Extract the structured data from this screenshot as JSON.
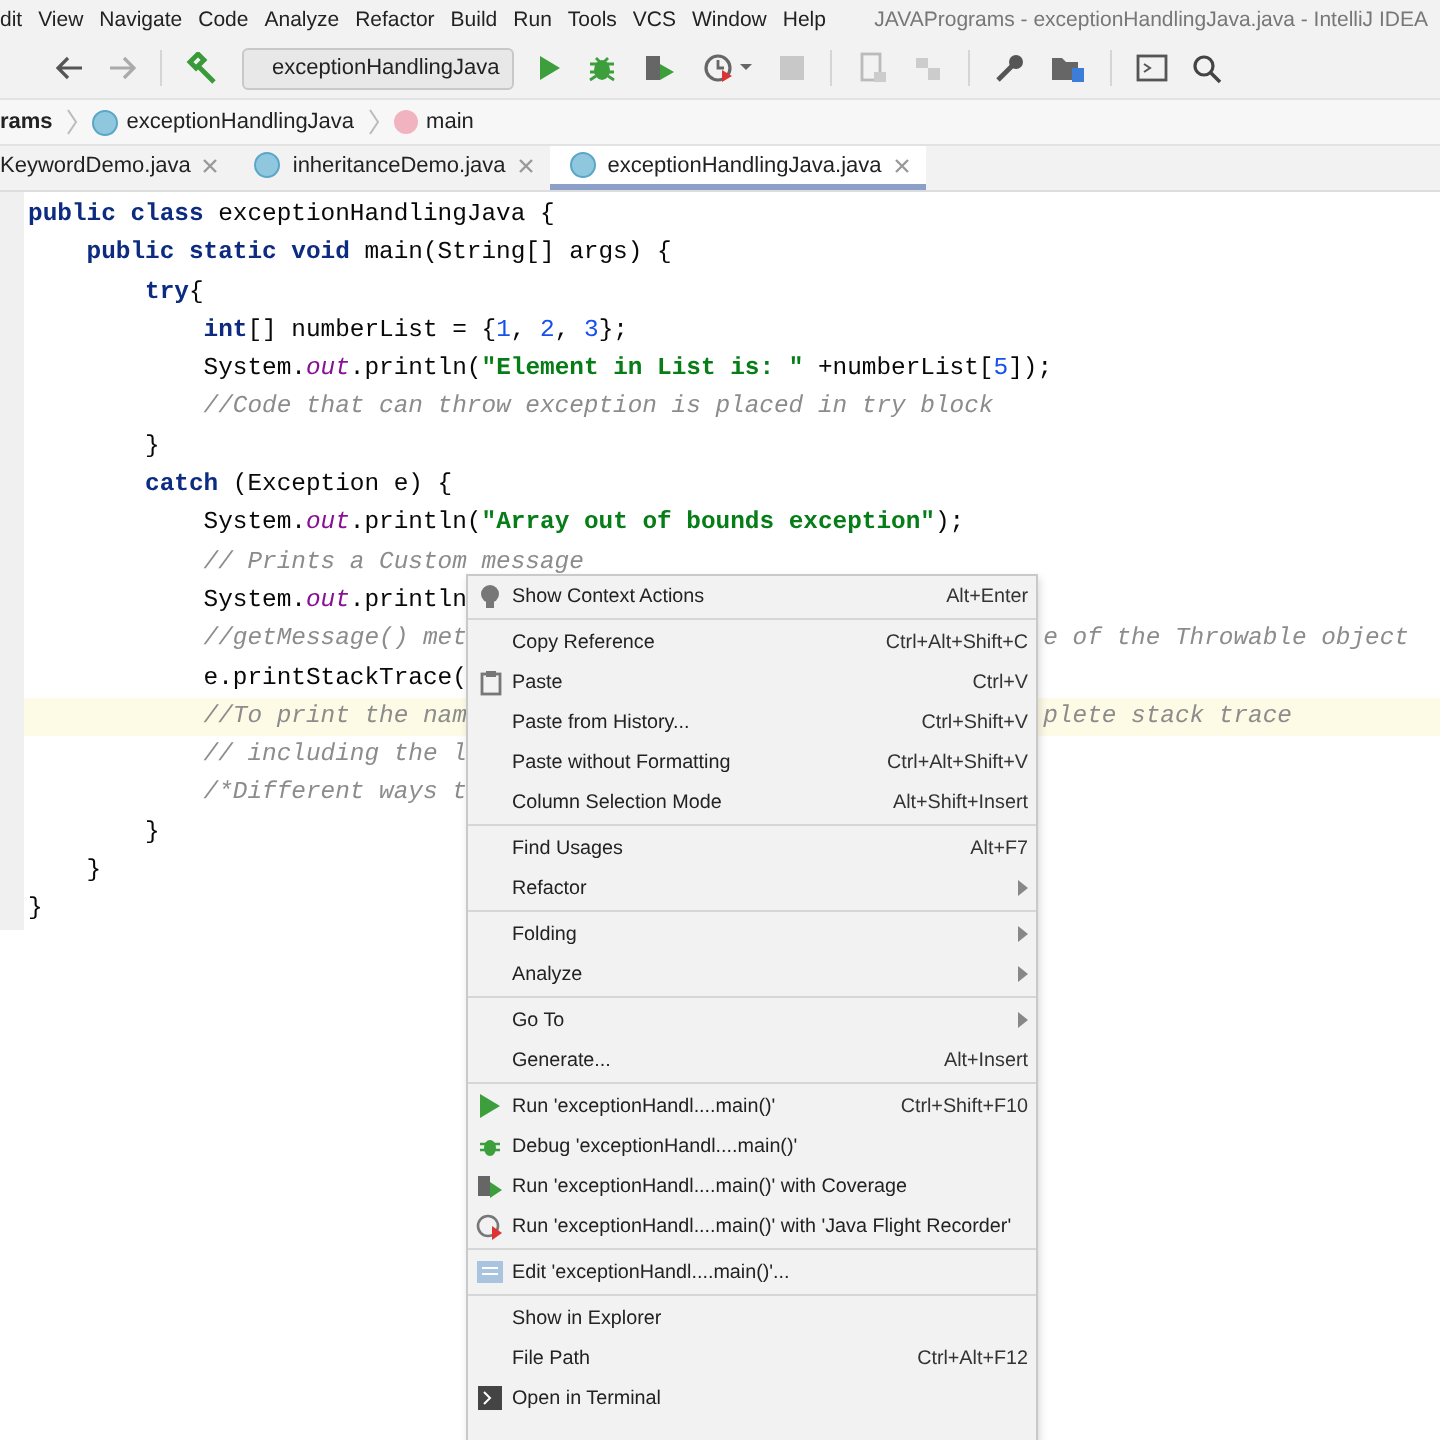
{
  "menubar": [
    "dit",
    "View",
    "Navigate",
    "Code",
    "Analyze",
    "Refactor",
    "Build",
    "Run",
    "Tools",
    "VCS",
    "Window",
    "Help"
  ],
  "window": {
    "title": "JAVAPrograms - exceptionHandlingJava.java - IntelliJ IDEA"
  },
  "toolbar": {
    "run_config": "exceptionHandlingJava"
  },
  "breadcrumbs": [
    {
      "label": "rams",
      "kind": "project"
    },
    {
      "label": "exceptionHandlingJava",
      "kind": "class"
    },
    {
      "label": "main",
      "kind": "method"
    }
  ],
  "tabs": [
    {
      "label": "KeywordDemo.java",
      "selected": false,
      "icon": false
    },
    {
      "label": "inheritanceDemo.java",
      "selected": false,
      "icon": true
    },
    {
      "label": "exceptionHandlingJava.java",
      "selected": true,
      "icon": true
    }
  ],
  "code": [
    {
      "current": false,
      "segments": [
        {
          "text": "public class ",
          "kind": "keyword"
        },
        {
          "text": "exceptionHandlingJava {",
          "kind": "plain"
        }
      ]
    },
    {
      "current": false,
      "segments": [
        {
          "text": "    public static void ",
          "kind": "keyword"
        },
        {
          "text": "main(String[] args) {",
          "kind": "plain"
        }
      ]
    },
    {
      "current": false,
      "segments": [
        {
          "text": "        try",
          "kind": "keyword"
        },
        {
          "text": "{",
          "kind": "plain"
        }
      ]
    },
    {
      "current": false,
      "segments": [
        {
          "text": "            int",
          "kind": "keyword"
        },
        {
          "text": "[] numberList = {",
          "kind": "plain"
        },
        {
          "text": "1",
          "kind": "number"
        },
        {
          "text": ", ",
          "kind": "plain"
        },
        {
          "text": "2",
          "kind": "number"
        },
        {
          "text": ", ",
          "kind": "plain"
        },
        {
          "text": "3",
          "kind": "number"
        },
        {
          "text": "};",
          "kind": "plain"
        }
      ]
    },
    {
      "current": false,
      "segments": [
        {
          "text": "            System.",
          "kind": "plain"
        },
        {
          "text": "out",
          "kind": "field"
        },
        {
          "text": ".println(",
          "kind": "plain"
        },
        {
          "text": "\"Element in List is: \"",
          "kind": "string"
        },
        {
          "text": " +numberList[",
          "kind": "plain"
        },
        {
          "text": "5",
          "kind": "number"
        },
        {
          "text": "]);",
          "kind": "plain"
        }
      ]
    },
    {
      "current": false,
      "segments": [
        {
          "text": "            //Code that can throw exception is placed in try block",
          "kind": "comment"
        }
      ]
    },
    {
      "current": false,
      "segments": [
        {
          "text": "        }",
          "kind": "plain"
        }
      ]
    },
    {
      "current": false,
      "segments": [
        {
          "text": "        catch ",
          "kind": "keyword"
        },
        {
          "text": "(Exception e) {",
          "kind": "plain"
        }
      ]
    },
    {
      "current": false,
      "segments": [
        {
          "text": "            System.",
          "kind": "plain"
        },
        {
          "text": "out",
          "kind": "field"
        },
        {
          "text": ".println(",
          "kind": "plain"
        },
        {
          "text": "\"Array out of bounds exception\"",
          "kind": "string"
        },
        {
          "text": ");",
          "kind": "plain"
        }
      ]
    },
    {
      "current": false,
      "segments": [
        {
          "text": "            // Prints a Custom message",
          "kind": "comment"
        }
      ]
    },
    {
      "current": false,
      "segments": [
        {
          "text": "            System.",
          "kind": "plain"
        },
        {
          "text": "out",
          "kind": "field"
        },
        {
          "text": ".println",
          "kind": "plain"
        }
      ]
    },
    {
      "current": false,
      "segments": [
        {
          "text": "            //getMessage() met",
          "kind": "comment"
        }
      ],
      "after_menu": {
        "text": "e of the Throwable object",
        "kind": "comment"
      }
    },
    {
      "current": false,
      "segments": [
        {
          "text": "            e.printStackTrace(",
          "kind": "plain"
        }
      ]
    },
    {
      "current": true,
      "segments": [
        {
          "text": "            //To print the nam",
          "kind": "comment"
        }
      ],
      "after_menu": {
        "text": "plete stack trace",
        "kind": "comment"
      }
    },
    {
      "current": false,
      "segments": [
        {
          "text": "            // including the l",
          "kind": "comment"
        }
      ]
    },
    {
      "current": false,
      "segments": [
        {
          "text": "            /*Different ways t",
          "kind": "comment"
        }
      ]
    },
    {
      "current": false,
      "segments": [
        {
          "text": "        }",
          "kind": "plain"
        }
      ]
    },
    {
      "current": false,
      "segments": [
        {
          "text": "    }",
          "kind": "plain"
        }
      ]
    },
    {
      "current": false,
      "segments": [
        {
          "text": "}",
          "kind": "plain"
        }
      ]
    }
  ],
  "context_menu": [
    [
      {
        "label": "Show Context Actions",
        "shortcut": "Alt+Enter",
        "submenu": false,
        "kind": "bulb"
      }
    ],
    [
      {
        "label": "Copy Reference",
        "shortcut": "Ctrl+Alt+Shift+C",
        "submenu": false,
        "kind": "plain"
      },
      {
        "label": "Paste",
        "shortcut": "Ctrl+V",
        "submenu": false,
        "kind": "clipboard"
      },
      {
        "label": "Paste from History...",
        "shortcut": "Ctrl+Shift+V",
        "submenu": false,
        "kind": "plain"
      },
      {
        "label": "Paste without Formatting",
        "shortcut": "Ctrl+Alt+Shift+V",
        "submenu": false,
        "kind": "plain"
      },
      {
        "label": "Column Selection Mode",
        "shortcut": "Alt+Shift+Insert",
        "submenu": false,
        "kind": "plain"
      }
    ],
    [
      {
        "label": "Find Usages",
        "shortcut": "Alt+F7",
        "submenu": false,
        "kind": "plain"
      },
      {
        "label": "Refactor",
        "submenu": true,
        "kind": "plain"
      }
    ],
    [
      {
        "label": "Folding",
        "submenu": true,
        "kind": "plain"
      },
      {
        "label": "Analyze",
        "submenu": true,
        "kind": "plain"
      }
    ],
    [
      {
        "label": "Go To",
        "submenu": true,
        "kind": "plain"
      },
      {
        "label": "Generate...",
        "shortcut": "Alt+Insert",
        "submenu": false,
        "kind": "plain"
      }
    ],
    [
      {
        "label": "Run 'exceptionHandl....main()'",
        "shortcut": "Ctrl+Shift+F10",
        "submenu": false,
        "kind": "run"
      },
      {
        "label": "Debug 'exceptionHandl....main()'",
        "submenu": false,
        "kind": "debug"
      },
      {
        "label": "Run 'exceptionHandl....main()' with Coverage",
        "submenu": false,
        "kind": "coverage"
      },
      {
        "label": "Run 'exceptionHandl....main()' with 'Java Flight Recorder'",
        "submenu": false,
        "kind": "profile"
      }
    ],
    [
      {
        "label": "Edit 'exceptionHandl....main()'...",
        "submenu": false,
        "kind": "config"
      }
    ],
    [
      {
        "label": "Show in Explorer",
        "submenu": false,
        "kind": "plain"
      },
      {
        "label": "File Path",
        "shortcut": "Ctrl+Alt+F12",
        "submenu": false,
        "kind": "plain"
      },
      {
        "label": "Open in Terminal",
        "submenu": false,
        "kind": "terminal"
      }
    ]
  ]
}
